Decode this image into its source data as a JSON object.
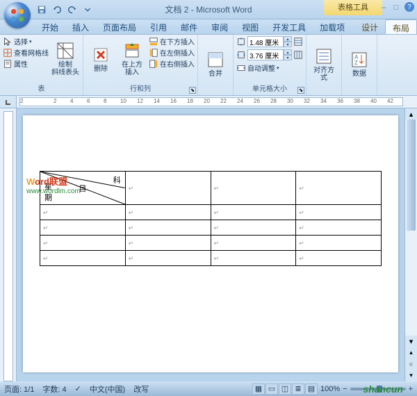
{
  "title": "文档 2 - Microsoft Word",
  "context_tool": "表格工具",
  "win_controls": {
    "min": "–",
    "max": "□",
    "close": "X"
  },
  "tabs": [
    "开始",
    "插入",
    "页面布局",
    "引用",
    "邮件",
    "审阅",
    "视图",
    "开发工具",
    "加载项"
  ],
  "context_tabs": [
    "设计",
    "布局"
  ],
  "active_tab": "布局",
  "ribbon": {
    "table_group": {
      "label": "表",
      "select": "选择",
      "grid": "查看网格线",
      "props": "属性",
      "draw": "绘制\n斜线表头"
    },
    "rowcol_group": {
      "label": "行和列",
      "delete": "删除",
      "ins_above": "在上方\n插入",
      "ins_below": "在下方插入",
      "ins_left": "在左侧插入",
      "ins_right": "在右侧插入"
    },
    "merge_group": {
      "label": "合并",
      "merge": "合并"
    },
    "size_group": {
      "label": "单元格大小",
      "height": "1.48 厘米",
      "width": "3.76 厘米",
      "auto": "自动调整"
    },
    "align_group": {
      "label": "对齐方式"
    },
    "data_group": {
      "label": "数据"
    }
  },
  "ruler_marks": [
    "2",
    "",
    "2",
    "4",
    "6",
    "8",
    "10",
    "12",
    "14",
    "16",
    "18",
    "20",
    "22",
    "24",
    "26",
    "28",
    "30",
    "32",
    "34",
    "36",
    "38",
    "40",
    "42"
  ],
  "watermark": {
    "line1_a": "W",
    "line1_b": "ord联盟",
    "line2": "www.wordlm.com"
  },
  "diag_cell": {
    "top": "科",
    "mid": "目",
    "bottom": "星\n期"
  },
  "chart_data": {
    "type": "table",
    "rows": 5,
    "cols": 4,
    "header_cell": {
      "top_right": "科",
      "middle": "目",
      "bottom_left": "星期"
    },
    "cells_empty": true
  },
  "status": {
    "page": "页面: 1/1",
    "words": "字数: 4",
    "lang": "中文(中国)",
    "mode": "改写",
    "zoom": "100%"
  },
  "brand": "shancun"
}
